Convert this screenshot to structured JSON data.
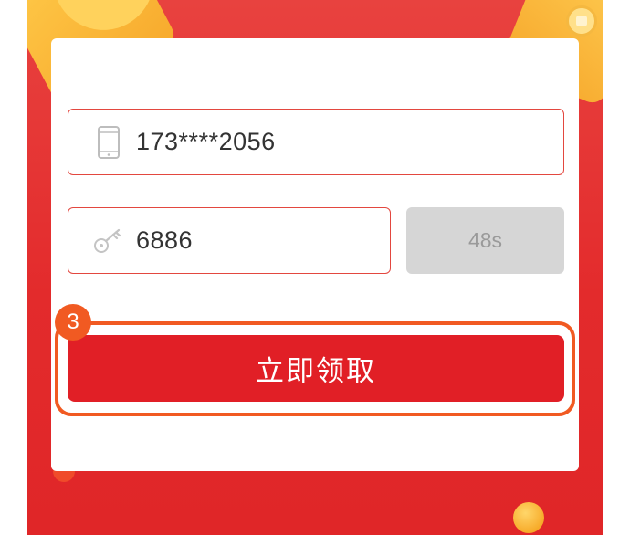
{
  "form": {
    "phone": {
      "value": "173****2056",
      "icon": "phone-icon"
    },
    "code": {
      "value": "6886",
      "icon": "key-icon"
    },
    "countdown_label": "48s",
    "claim_label": "立即领取"
  },
  "guide": {
    "step_number": "3",
    "highlight_color": "#f15a22"
  },
  "colors": {
    "background": "#e32b2c",
    "primary_button": "#e11f26",
    "field_border": "#e3473f",
    "disabled_button": "#d6d6d6"
  }
}
